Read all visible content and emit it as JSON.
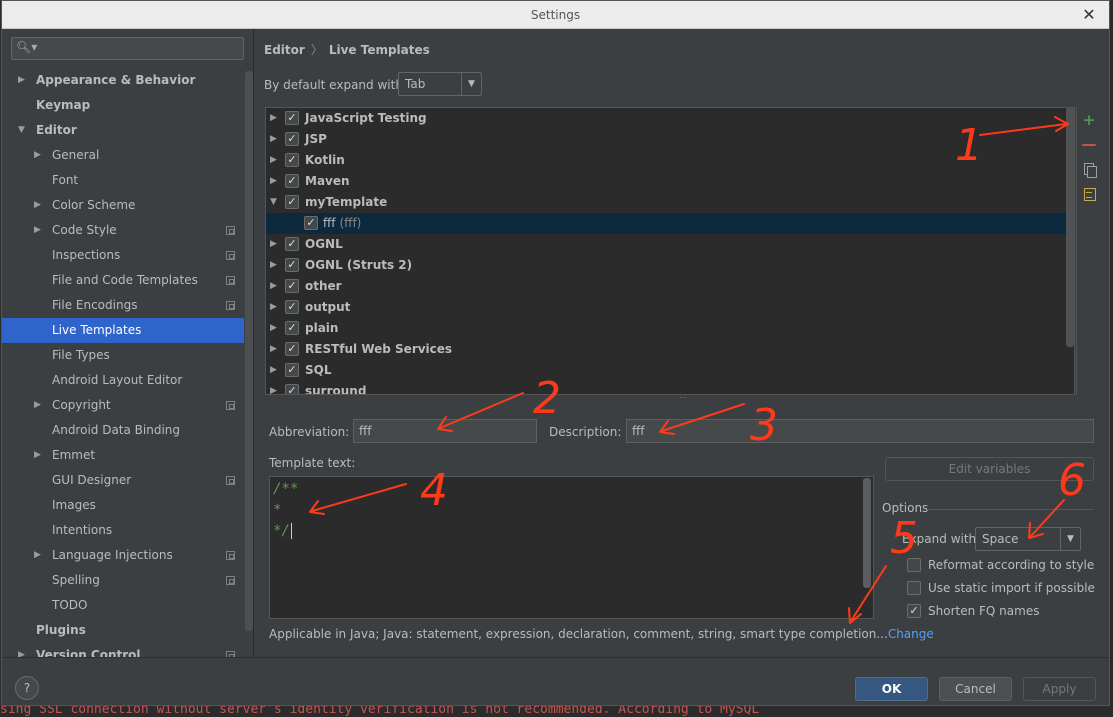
{
  "window": {
    "title": "Settings"
  },
  "background_text": "sing SSL connection without server's identity verification is not recommended. According to MySQL",
  "sidebar": {
    "items": [
      {
        "label": "Appearance & Behavior",
        "level": 0,
        "arrow": "right",
        "bold": true
      },
      {
        "label": "Keymap",
        "level": 0,
        "arrow": "",
        "bold": true
      },
      {
        "label": "Editor",
        "level": 0,
        "arrow": "down",
        "bold": true
      },
      {
        "label": "General",
        "level": 1,
        "arrow": "right"
      },
      {
        "label": "Font",
        "level": 1,
        "arrow": ""
      },
      {
        "label": "Color Scheme",
        "level": 1,
        "arrow": "right"
      },
      {
        "label": "Code Style",
        "level": 1,
        "arrow": "right",
        "project": true
      },
      {
        "label": "Inspections",
        "level": 1,
        "arrow": "",
        "project": true
      },
      {
        "label": "File and Code Templates",
        "level": 1,
        "arrow": "",
        "project": true
      },
      {
        "label": "File Encodings",
        "level": 1,
        "arrow": "",
        "project": true
      },
      {
        "label": "Live Templates",
        "level": 1,
        "arrow": "",
        "selected": true
      },
      {
        "label": "File Types",
        "level": 1,
        "arrow": ""
      },
      {
        "label": "Android Layout Editor",
        "level": 1,
        "arrow": ""
      },
      {
        "label": "Copyright",
        "level": 1,
        "arrow": "right",
        "project": true
      },
      {
        "label": "Android Data Binding",
        "level": 1,
        "arrow": ""
      },
      {
        "label": "Emmet",
        "level": 1,
        "arrow": "right"
      },
      {
        "label": "GUI Designer",
        "level": 1,
        "arrow": "",
        "project": true
      },
      {
        "label": "Images",
        "level": 1,
        "arrow": ""
      },
      {
        "label": "Intentions",
        "level": 1,
        "arrow": ""
      },
      {
        "label": "Language Injections",
        "level": 1,
        "arrow": "right",
        "project": true
      },
      {
        "label": "Spelling",
        "level": 1,
        "arrow": "",
        "project": true
      },
      {
        "label": "TODO",
        "level": 1,
        "arrow": ""
      },
      {
        "label": "Plugins",
        "level": 0,
        "arrow": "",
        "bold": true
      },
      {
        "label": "Version Control",
        "level": 0,
        "arrow": "right",
        "bold": true,
        "project": true
      }
    ]
  },
  "breadcrumb": {
    "parent": "Editor",
    "separator": "〉",
    "current": "Live Templates"
  },
  "expand_default": {
    "label": "By default expand with",
    "value": "Tab"
  },
  "template_groups": [
    {
      "name": "JavaScript Testing",
      "expanded": false,
      "checked": true
    },
    {
      "name": "JSP",
      "expanded": false,
      "checked": true
    },
    {
      "name": "Kotlin",
      "expanded": false,
      "checked": true
    },
    {
      "name": "Maven",
      "expanded": false,
      "checked": true
    },
    {
      "name": "myTemplate",
      "expanded": true,
      "checked": true
    },
    {
      "name": "fff",
      "desc": "(fff)",
      "child": true,
      "checked": true,
      "selected": true
    },
    {
      "name": "OGNL",
      "expanded": false,
      "checked": true
    },
    {
      "name": "OGNL (Struts 2)",
      "expanded": false,
      "checked": true
    },
    {
      "name": "other",
      "expanded": false,
      "checked": true
    },
    {
      "name": "output",
      "expanded": false,
      "checked": true
    },
    {
      "name": "plain",
      "expanded": false,
      "checked": true
    },
    {
      "name": "RESTful Web Services",
      "expanded": false,
      "checked": true
    },
    {
      "name": "SQL",
      "expanded": false,
      "checked": true
    },
    {
      "name": "surround",
      "expanded": false,
      "checked": true
    }
  ],
  "toolbar": {
    "add": "+",
    "remove": "—"
  },
  "form": {
    "abbreviation_label": "Abbreviation:",
    "abbreviation_value": "fff",
    "description_label": "Description:",
    "description_value": "fff",
    "template_text_label": "Template text:",
    "template_lines": [
      "/**",
      "*",
      "*/"
    ],
    "edit_variables": "Edit variables",
    "options_label": "Options",
    "expand_with_label": "Expand with",
    "expand_with_value": "Space",
    "reformat_label": "Reformat according to style",
    "static_import_label": "Use static import if possible",
    "shorten_label": "Shorten FQ names",
    "applicable_text": "Applicable in Java; Java: statement, expression, declaration, comment, string, smart type completion...",
    "change_link": "Change"
  },
  "checks": {
    "reformat": false,
    "static_import": false,
    "shorten": true
  },
  "footer": {
    "help": "?",
    "ok": "OK",
    "cancel": "Cancel",
    "apply": "Apply"
  },
  "annotations": [
    "1",
    "2",
    "3",
    "4",
    "5",
    "6"
  ],
  "colors": {
    "accent": "#2f65ca",
    "annotation": "#ff3a1a",
    "link": "#589df6",
    "add": "#499c54",
    "remove": "#c75450"
  }
}
